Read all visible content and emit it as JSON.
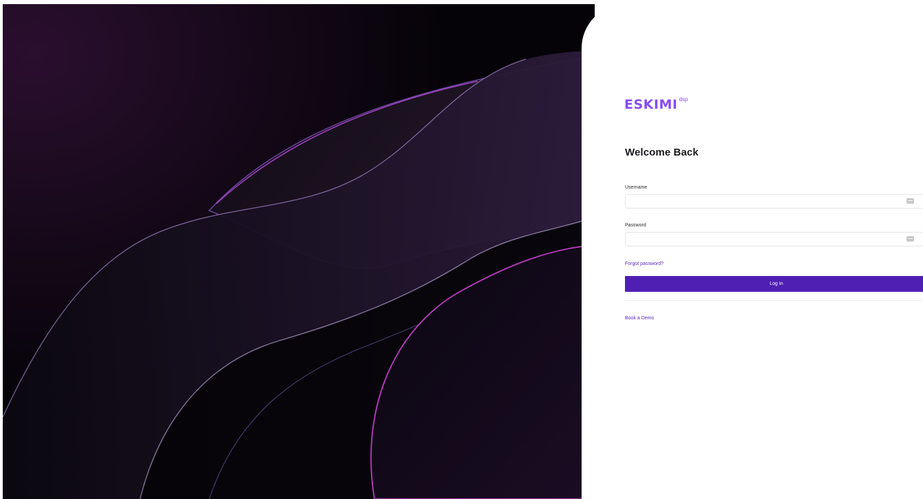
{
  "brand": {
    "name": "ESKIMI",
    "suffix": "dsp",
    "accent_color": "#8a4cf0",
    "primary_button_color": "#4f1fb3"
  },
  "hero": {
    "description_icon": "abstract-wave-background"
  },
  "login": {
    "heading": "Welcome Back",
    "username_label": "Username",
    "username_value": "",
    "username_icon": "key-icon",
    "password_label": "Password",
    "password_value": "",
    "password_icon": "key-icon",
    "forgot_link": "Forgot password?",
    "submit_label": "Log In",
    "demo_link": "Book a Demo"
  }
}
